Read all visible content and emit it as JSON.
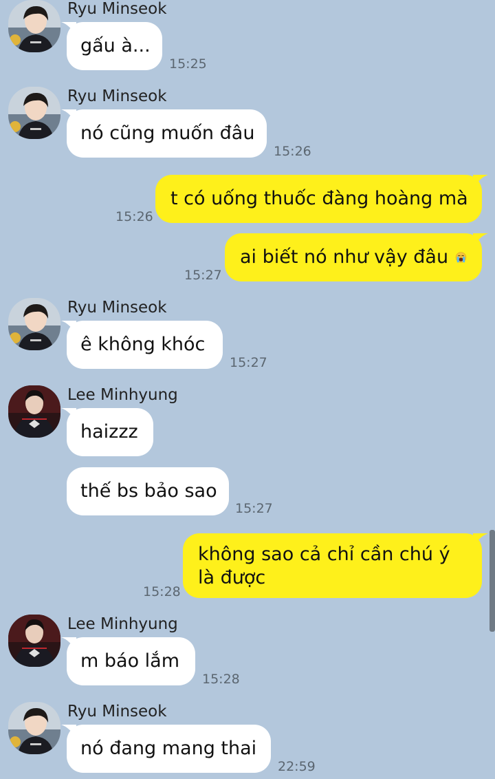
{
  "conversation": {
    "messages": [
      {
        "sender": "Ryu Minseok",
        "text": "gấu à...",
        "time": "15:25",
        "direction": "incoming"
      },
      {
        "sender": "Ryu Minseok",
        "text": "nó cũng muốn đâu",
        "time": "15:26",
        "direction": "incoming"
      },
      {
        "sender": "",
        "text": "t có uống thuốc đàng hoàng mà",
        "time": "15:26",
        "direction": "outgoing"
      },
      {
        "sender": "",
        "text": "ai biết nó như vậy đâu",
        "emoji": "loudly-crying-face",
        "time": "15:27",
        "direction": "outgoing"
      },
      {
        "sender": "Ryu Minseok",
        "text": "ê không khóc",
        "time": "15:27",
        "direction": "incoming"
      },
      {
        "sender": "Lee Minhyung",
        "text": "haizzz",
        "time": "",
        "direction": "incoming"
      },
      {
        "sender": "Lee Minhyung",
        "text": "thế bs bảo sao",
        "time": "15:27",
        "direction": "incoming"
      },
      {
        "sender": "",
        "text": "không sao cả chỉ cần chú ý là được",
        "time": "15:28",
        "direction": "outgoing"
      },
      {
        "sender": "Lee Minhyung",
        "text": "m báo lắm",
        "time": "15:28",
        "direction": "incoming"
      },
      {
        "sender": "Ryu Minseok",
        "text": "nó đang mang thai",
        "time": "22:59",
        "direction": "incoming"
      }
    ]
  },
  "colors": {
    "background": "#b3c7dc",
    "incoming_bubble": "#ffffff",
    "outgoing_bubble": "#fef01b",
    "timestamp": "#5b6670"
  },
  "icons": {
    "avatar_ryu": "ryu-minseok-avatar",
    "avatar_lee": "lee-minhyung-avatar",
    "emoji": "loudly-crying-face-icon"
  }
}
